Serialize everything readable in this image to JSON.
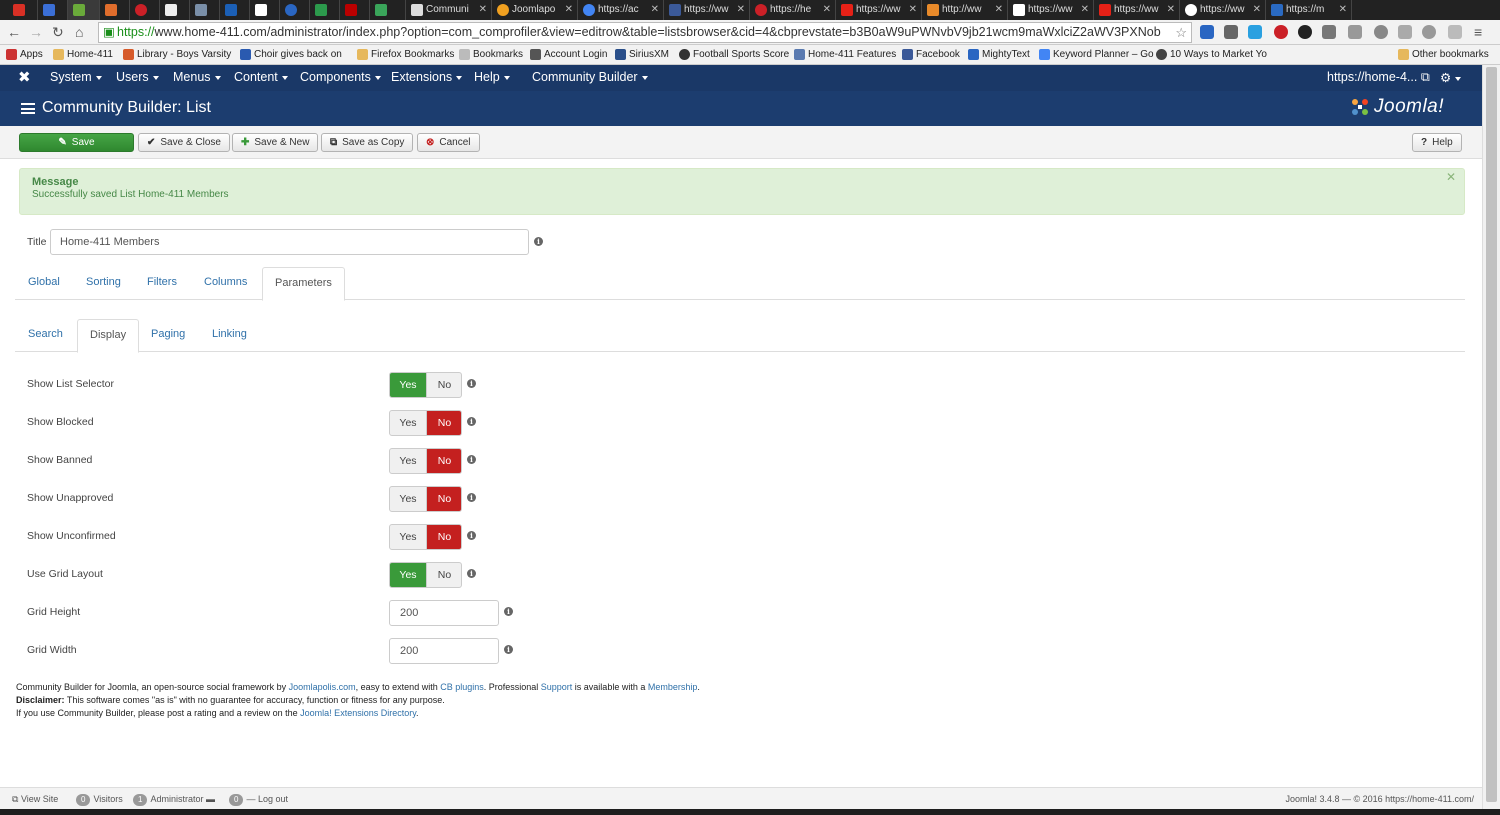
{
  "browser": {
    "tabs": [
      "",
      "",
      "",
      "",
      "",
      "",
      "",
      "",
      "",
      "",
      "",
      "",
      "Communi",
      "Joomlapo",
      "https://ac",
      "https://ww",
      "https://he",
      "https://ww",
      "http://ww",
      "https://ww",
      "https://ww",
      "https://ww",
      "https://m"
    ],
    "url_scheme": "https://",
    "url_rest": "www.home-411.com/administrator/index.php?option=com_comprofiler&view=editrow&table=listsbrowser&cid=4&cbprevstate=b3B0aW9uPWNvbV9jb21wcm9maWxlciZ2aWV3PXNob",
    "bookmarks": [
      "Apps",
      "Home-411",
      "Library - Boys Varsity",
      "Choir gives back on",
      "Firefox Bookmarks",
      "Bookmarks",
      "Account Login",
      "SiriusXM",
      "Football Sports Score",
      "Home-411 Features",
      "Facebook",
      "MightyText",
      "Keyword Planner – Go",
      "10 Ways to Market Yo"
    ],
    "other_bookmarks": "Other bookmarks"
  },
  "admin": {
    "menu": [
      "System",
      "Users",
      "Menus",
      "Content",
      "Components",
      "Extensions",
      "Help",
      "Community Builder"
    ],
    "site_link": "https://home-4...",
    "page_title": "Community Builder: List",
    "logo": "Joomla!"
  },
  "toolbar": {
    "save": "Save",
    "save_close": "Save & Close",
    "save_new": "Save & New",
    "save_copy": "Save as Copy",
    "cancel": "Cancel",
    "help": "Help"
  },
  "message": {
    "heading": "Message",
    "text": "Successfully saved List Home-411 Members"
  },
  "form": {
    "title_label": "Title",
    "title_value": "Home-411 Members",
    "tabs": [
      "Global",
      "Sorting",
      "Filters",
      "Columns",
      "Parameters"
    ],
    "subtabs": [
      "Search",
      "Display",
      "Paging",
      "Linking"
    ],
    "yes": "Yes",
    "no": "No",
    "toggles": [
      {
        "label": "Show List Selector",
        "value": "Yes"
      },
      {
        "label": "Show Blocked",
        "value": "No"
      },
      {
        "label": "Show Banned",
        "value": "No"
      },
      {
        "label": "Show Unapproved",
        "value": "No"
      },
      {
        "label": "Show Unconfirmed",
        "value": "No"
      },
      {
        "label": "Use Grid Layout",
        "value": "Yes"
      }
    ],
    "grid_height_label": "Grid Height",
    "grid_height": "200",
    "grid_width_label": "Grid Width",
    "grid_width": "200"
  },
  "footer": {
    "l1a": "Community Builder for Joomla, an open-source social framework by ",
    "l1b": "Joomlapolis.com",
    "l1c": ", easy to extend with ",
    "l1d": "CB plugins",
    "l1e": ". Professional ",
    "l1f": "Support",
    "l1g": " is available with a ",
    "l1h": "Membership",
    "l1i": ".",
    "l2a": "Disclaimer:",
    "l2b": " This software comes \"as is\" with no guarantee for accuracy, function or fitness for any purpose.",
    "l3a": "If you use Community Builder, please post a rating and a review on the ",
    "l3b": "Joomla! Extensions Directory",
    "l3c": "."
  },
  "status": {
    "view_site": "View Site",
    "visitors_count": "0",
    "visitors": "Visitors",
    "admin_count": "1",
    "administrator": "Administrator",
    "msg_count": "0",
    "logout": "Log out",
    "version": "Joomla! 3.4.8 — © 2016 https://home-411.com/"
  }
}
